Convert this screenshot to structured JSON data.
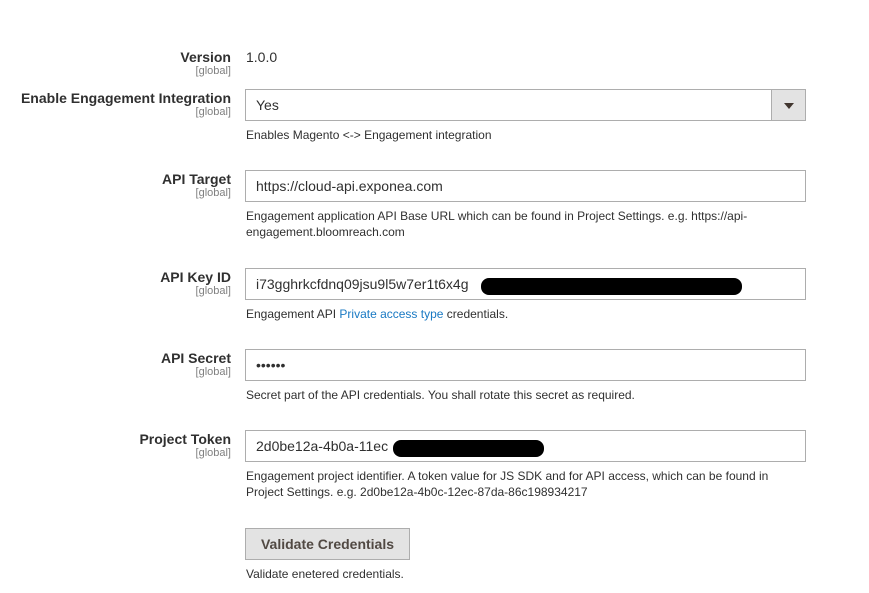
{
  "fields": {
    "version": {
      "label": "Version",
      "scope": "[global]",
      "value": "1.0.0"
    },
    "enable": {
      "label": "Enable Engagement Integration",
      "scope": "[global]",
      "value": "Yes",
      "note": "Enables Magento <-> Engagement integration"
    },
    "api_target": {
      "label": "API Target",
      "scope": "[global]",
      "value": "https://cloud-api.exponea.com",
      "note": "Engagement application API Base URL which can be found in Project Settings. e.g. https://api-engagement.bloomreach.com"
    },
    "api_key": {
      "label": "API Key ID",
      "scope": "[global]",
      "value": "i73gghrkcfdnq09jsu9l5w7er1t6x4g",
      "note_before": "Engagement API ",
      "note_link": "Private access type",
      "note_after": " credentials."
    },
    "api_secret": {
      "label": "API Secret",
      "scope": "[global]",
      "value": "••••••",
      "note": "Secret part of the API credentials. You shall rotate this secret as required."
    },
    "project_token": {
      "label": "Project Token",
      "scope": "[global]",
      "value": "2d0be12a-4b0a-11ec",
      "note": "Engagement project identifier. A token value for JS SDK and for API access, which can be found in Project Settings. e.g. 2d0be12a-4b0c-12ec-87da-86c198934217"
    }
  },
  "validate": {
    "button_label": "Validate Credentials",
    "note": "Validate enetered credentials."
  }
}
